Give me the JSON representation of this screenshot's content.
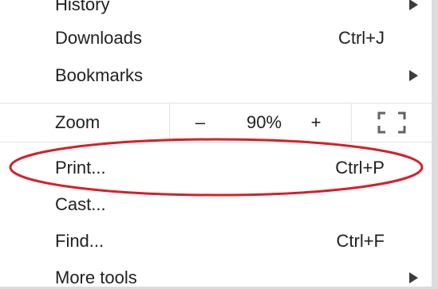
{
  "menu": {
    "history": {
      "label": "History",
      "has_submenu": true
    },
    "downloads": {
      "label": "Downloads",
      "shortcut": "Ctrl+J"
    },
    "bookmarks": {
      "label": "Bookmarks",
      "has_submenu": true
    },
    "zoom": {
      "label": "Zoom",
      "decrease_label": "–",
      "value": "90%",
      "increase_label": "+",
      "fullscreen_icon": "fullscreen-icon"
    },
    "print": {
      "label": "Print...",
      "shortcut": "Ctrl+P",
      "highlighted": true
    },
    "cast": {
      "label": "Cast..."
    },
    "find": {
      "label": "Find...",
      "shortcut": "Ctrl+F"
    },
    "more_tools": {
      "label": "More tools",
      "has_submenu": true
    }
  },
  "colors": {
    "text": "#202124",
    "divider": "#e3e3e3",
    "highlight_ellipse": "#d4202a"
  }
}
